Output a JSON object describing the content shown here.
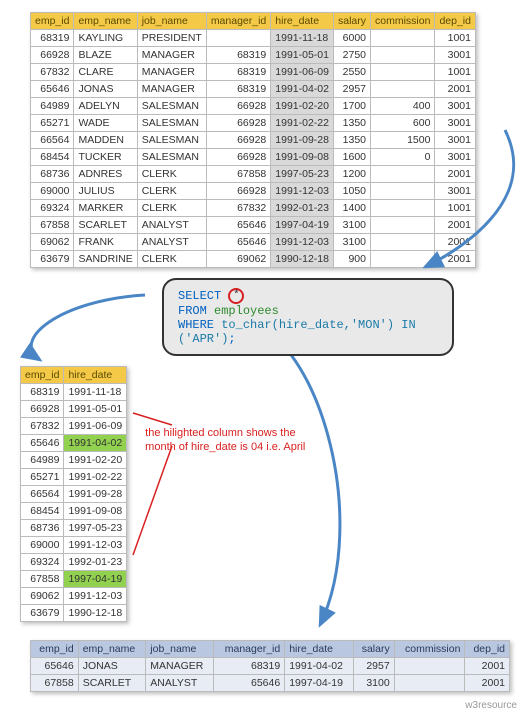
{
  "main_table": {
    "headers": [
      "emp_id",
      "emp_name",
      "job_name",
      "manager_id",
      "hire_date",
      "salary",
      "commission",
      "dep_id"
    ],
    "rows": [
      [
        "68319",
        "KAYLING",
        "PRESIDENT",
        "",
        "1991-11-18",
        "6000",
        "",
        "1001"
      ],
      [
        "66928",
        "BLAZE",
        "MANAGER",
        "68319",
        "1991-05-01",
        "2750",
        "",
        "3001"
      ],
      [
        "67832",
        "CLARE",
        "MANAGER",
        "68319",
        "1991-06-09",
        "2550",
        "",
        "1001"
      ],
      [
        "65646",
        "JONAS",
        "MANAGER",
        "68319",
        "1991-04-02",
        "2957",
        "",
        "2001"
      ],
      [
        "64989",
        "ADELYN",
        "SALESMAN",
        "66928",
        "1991-02-20",
        "1700",
        "400",
        "3001"
      ],
      [
        "65271",
        "WADE",
        "SALESMAN",
        "66928",
        "1991-02-22",
        "1350",
        "600",
        "3001"
      ],
      [
        "66564",
        "MADDEN",
        "SALESMAN",
        "66928",
        "1991-09-28",
        "1350",
        "1500",
        "3001"
      ],
      [
        "68454",
        "TUCKER",
        "SALESMAN",
        "66928",
        "1991-09-08",
        "1600",
        "0",
        "3001"
      ],
      [
        "68736",
        "ADNRES",
        "CLERK",
        "67858",
        "1997-05-23",
        "1200",
        "",
        "2001"
      ],
      [
        "69000",
        "JULIUS",
        "CLERK",
        "66928",
        "1991-12-03",
        "1050",
        "",
        "3001"
      ],
      [
        "69324",
        "MARKER",
        "CLERK",
        "67832",
        "1992-01-23",
        "1400",
        "",
        "1001"
      ],
      [
        "67858",
        "SCARLET",
        "ANALYST",
        "65646",
        "1997-04-19",
        "3100",
        "",
        "2001"
      ],
      [
        "69062",
        "FRANK",
        "ANALYST",
        "65646",
        "1991-12-03",
        "3100",
        "",
        "2001"
      ],
      [
        "63679",
        "SANDRINE",
        "CLERK",
        "69062",
        "1990-12-18",
        "900",
        "",
        "2001"
      ]
    ]
  },
  "sql": {
    "line1_kw": "SELECT ",
    "star": "*",
    "line2_kw": "FROM ",
    "line2_ident": "employees",
    "line3_kw": "WHERE ",
    "line3_func": "to_char(hire_date,'MON') IN ('APR')",
    "semi": ";"
  },
  "hiredate_table": {
    "headers": [
      "emp_id",
      "hire_date"
    ],
    "rows": [
      [
        "68319",
        "1991-11-18"
      ],
      [
        "66928",
        "1991-05-01"
      ],
      [
        "67832",
        "1991-06-09"
      ],
      [
        "65646",
        "1991-04-02"
      ],
      [
        "64989",
        "1991-02-20"
      ],
      [
        "65271",
        "1991-02-22"
      ],
      [
        "66564",
        "1991-09-28"
      ],
      [
        "68454",
        "1991-09-08"
      ],
      [
        "68736",
        "1997-05-23"
      ],
      [
        "69000",
        "1991-12-03"
      ],
      [
        "69324",
        "1992-01-23"
      ],
      [
        "67858",
        "1997-04-19"
      ],
      [
        "69062",
        "1991-12-03"
      ],
      [
        "63679",
        "1990-12-18"
      ]
    ],
    "highlighted_emp_ids": [
      65646,
      67858
    ]
  },
  "note_line1": "the hilighted column shows the",
  "note_line2": "month of hire_date is 04 i.e. April",
  "result_table": {
    "headers": [
      "emp_id",
      "emp_name",
      "job_name",
      "manager_id",
      "hire_date",
      "salary",
      "commission",
      "dep_id"
    ],
    "rows": [
      [
        "65646",
        "JONAS",
        "MANAGER",
        "68319",
        "1991-04-02",
        "2957",
        "",
        "2001"
      ],
      [
        "67858",
        "SCARLET",
        "ANALYST",
        "65646",
        "1997-04-19",
        "3100",
        "",
        "2001"
      ]
    ]
  },
  "footer": "w3resource"
}
